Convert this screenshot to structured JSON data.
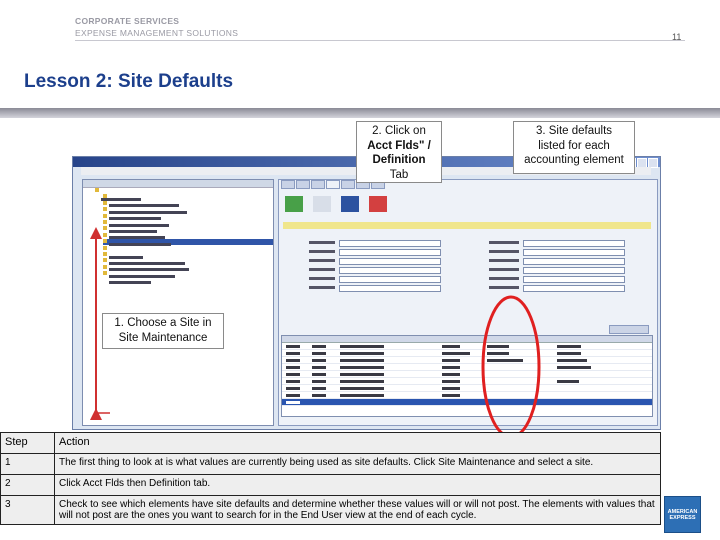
{
  "header": {
    "company_line1": "CORPORATE SERVICES",
    "company_line2": "EXPENSE MANAGEMENT SOLUTIONS",
    "page_number": "11"
  },
  "title": "Lesson 2:  Site Defaults",
  "callouts": {
    "choose_site_line1": "1. Choose a Site in",
    "choose_site_line2": "Site Maintenance",
    "acct_line1": "2. Click on",
    "acct_line2": "Acct Flds\" /",
    "acct_line3": "Definition",
    "acct_line4": "Tab",
    "defaults_line1": "3. Site defaults",
    "defaults_line2": "listed for each",
    "defaults_line3": "accounting element"
  },
  "table": {
    "headers": [
      "Step",
      "Action"
    ],
    "rows": [
      {
        "step": "1",
        "action": "The first thing to look at is what values are currently being used as site defaults. Click Site Maintenance and select a site."
      },
      {
        "step": "2",
        "action": "Click Acct Flds then Definition tab."
      },
      {
        "step": "3",
        "action": "Check to see which elements have site defaults and determine whether these values will or will not post. The elements with values that will not post are the ones you want to search for in the End User view at the end of each cycle."
      }
    ]
  },
  "logo": {
    "text": "AMERICAN EXPRESS"
  },
  "colors": {
    "title": "#1c3f8c",
    "highlight_circle": "#e02020",
    "arrow": "#d03030"
  }
}
